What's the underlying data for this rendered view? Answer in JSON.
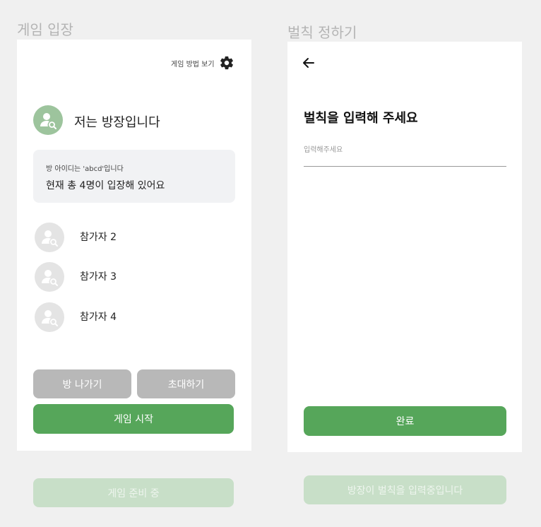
{
  "left": {
    "frame_label": "게임 입장",
    "help_label": "게임 방법 보기",
    "host_name": "저는 방장입니다",
    "room_id_text": "방 아이디는 'abcd'입니다",
    "count_text": "현재 총 4명이 입장해 있어요",
    "participants": [
      {
        "name": "참가자 2"
      },
      {
        "name": "참가자 3"
      },
      {
        "name": "참가자 4"
      }
    ],
    "leave_label": "방 나가기",
    "invite_label": "초대하기",
    "start_label": "게임 시작",
    "ready_label": "게임 준비 중"
  },
  "right": {
    "frame_label": "벌칙 정하기",
    "heading": "벌칙을 입력해 주세요",
    "input_placeholder": "입력해주세요",
    "input_value": "",
    "done_label": "완료",
    "waiting_label": "방장이 벌칙을 입력중입니다"
  },
  "colors": {
    "accent": "#56a65a",
    "pale_accent": "#c8dfc8",
    "gray_button": "#b8b8b8",
    "host_avatar": "#9dc49d",
    "guest_avatar": "#e4e4e4"
  },
  "icons": [
    "gear-icon",
    "user-search-icon",
    "back-arrow-icon"
  ]
}
